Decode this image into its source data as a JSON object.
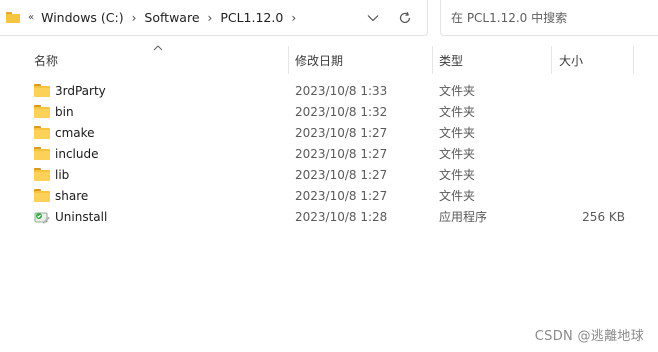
{
  "address_bar": {
    "overflow_label": "«",
    "breadcrumbs": [
      {
        "label": "Windows (C:)"
      },
      {
        "label": "Software"
      },
      {
        "label": "PCL1.12.0"
      }
    ],
    "separator": "›",
    "dropdown_icon": "chevron-down-icon",
    "refresh_icon": "refresh-icon",
    "folder_icon": "folder-icon"
  },
  "search": {
    "placeholder": "在 PCL1.12.0 中搜索"
  },
  "columns": {
    "name": "名称",
    "date": "修改日期",
    "type": "类型",
    "size": "大小",
    "sort_indicator": "sort-ascending-icon"
  },
  "files": [
    {
      "name": "3rdParty",
      "date": "2023/10/8 1:33",
      "type": "文件夹",
      "size": "",
      "icon": "folder-icon"
    },
    {
      "name": "bin",
      "date": "2023/10/8 1:32",
      "type": "文件夹",
      "size": "",
      "icon": "folder-icon"
    },
    {
      "name": "cmake",
      "date": "2023/10/8 1:27",
      "type": "文件夹",
      "size": "",
      "icon": "folder-icon"
    },
    {
      "name": "include",
      "date": "2023/10/8 1:27",
      "type": "文件夹",
      "size": "",
      "icon": "folder-icon"
    },
    {
      "name": "lib",
      "date": "2023/10/8 1:27",
      "type": "文件夹",
      "size": "",
      "icon": "folder-icon"
    },
    {
      "name": "share",
      "date": "2023/10/8 1:27",
      "type": "文件夹",
      "size": "",
      "icon": "folder-icon"
    },
    {
      "name": "Uninstall",
      "date": "2023/10/8 1:28",
      "type": "应用程序",
      "size": "256 KB",
      "icon": "uninstaller-icon"
    }
  ],
  "watermark": "CSDN @逃離地球",
  "colors": {
    "folder": "#f8c43f",
    "folder_tab": "#d99a1e",
    "border": "#e3e3e3",
    "secondary_text": "#5a5a5a"
  }
}
